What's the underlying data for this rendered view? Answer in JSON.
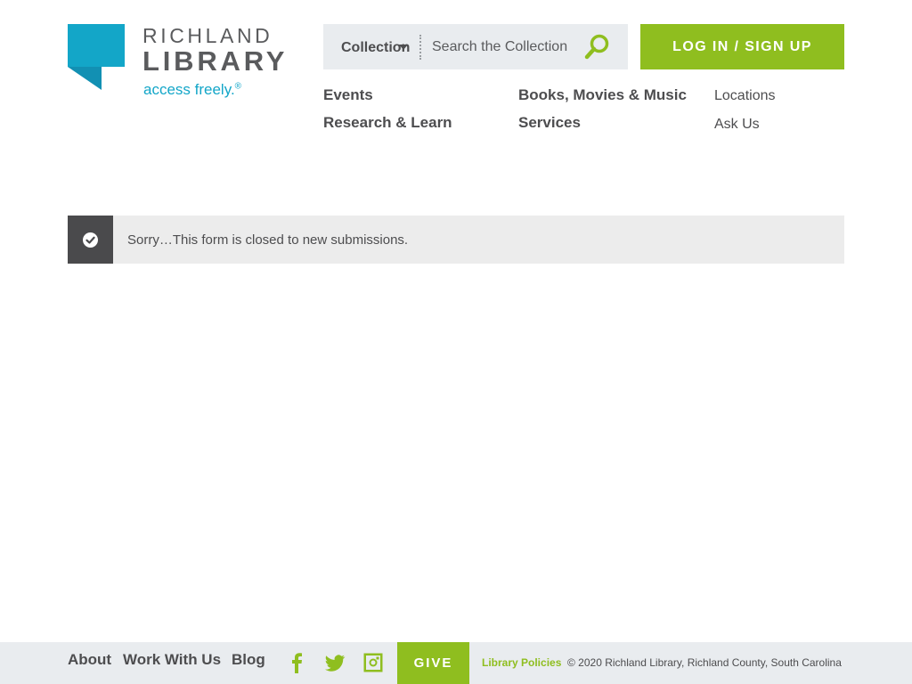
{
  "brand": {
    "name_line1": "RICHLAND",
    "name_line2": "LIBRARY",
    "tagline": "access freely.",
    "tagline_mark": "®",
    "logo_color": "#13a6c8"
  },
  "search": {
    "scope_label": "Collection",
    "placeholder": "Search the Collection",
    "icon": "search-icon"
  },
  "header": {
    "login_label": "LOG IN / SIGN UP",
    "accent_color": "#8fbe1f"
  },
  "nav": {
    "primary": [
      {
        "label": "Events"
      },
      {
        "label": "Research & Learn"
      },
      {
        "label": "Books, Movies & Music"
      },
      {
        "label": "Services"
      }
    ],
    "secondary": [
      {
        "label": "Locations"
      },
      {
        "label": "Ask Us"
      }
    ]
  },
  "alert": {
    "icon": "check-circle-icon",
    "message": "Sorry…This form is closed to new submissions."
  },
  "footer": {
    "links": [
      {
        "label": "About"
      },
      {
        "label": "Work With Us"
      },
      {
        "label": "Blog"
      }
    ],
    "social": [
      "facebook-icon",
      "twitter-icon",
      "instagram-icon"
    ],
    "give_label": "GIVE",
    "policies_label": "Library Policies",
    "copyright": "© 2020 Richland Library, Richland County, South Carolina"
  }
}
